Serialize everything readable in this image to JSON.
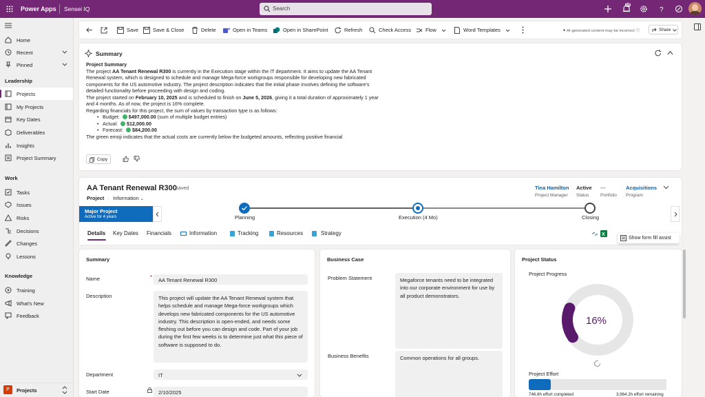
{
  "topbar": {
    "app_name": "Power Apps",
    "env_name": "Sensei IQ",
    "search_placeholder": "Search",
    "notification_count": "18",
    "colors": {
      "brand": "#742774",
      "accent": "#0f6cbd"
    }
  },
  "sidebar": {
    "top_items": [
      {
        "label": "Home",
        "icon": "home-icon"
      },
      {
        "label": "Recent",
        "icon": "clock-icon"
      },
      {
        "label": "Pinned",
        "icon": "pin-icon"
      }
    ],
    "groups": [
      {
        "title": "Leadership",
        "items": [
          "Projects",
          "My Projects",
          "Key Dates",
          "Deliverables",
          "Insights",
          "Project Summary"
        ]
      },
      {
        "title": "Work",
        "items": [
          "Tasks",
          "Issues",
          "Risks",
          "Decisions",
          "Changes",
          "Lessons"
        ]
      },
      {
        "title": "Knowledge",
        "items": [
          "Training",
          "What's New",
          "Feedback"
        ]
      }
    ],
    "area_badge": "P",
    "area_label": "Projects"
  },
  "commandbar": {
    "save": "Save",
    "save_close": "Save & Close",
    "delete": "Delete",
    "open_teams": "Open in Teams",
    "open_sharepoint": "Open in SharePoint",
    "refresh": "Refresh",
    "check_access": "Check Access",
    "flow": "Flow",
    "word_templates": "Word Templates",
    "ai_notice": "AI-generated content may be incorrect",
    "share": "Share"
  },
  "summary": {
    "title": "Summary",
    "heading": "Project Summary",
    "p1_a": "The project ",
    "p1_b": "AA Tenant Renewal R300",
    "p1_c": " is currently in the Execution stage within the IT department. It aims to update the AA Tenant Renewal system, which is designed to schedule and manage Mega-force workgroups responsible for developing new fabricated components for the US automotive industry. The project description indicates that the initial phase involves defining the software's detailed functionality before proceeding with design and coding.",
    "p2_a": "The project started on ",
    "p2_b": "February 10, 2025",
    "p2_c": " and is scheduled to finish on ",
    "p2_d": "June 5, 2026",
    "p2_e": ", giving it a total duration of approximately 1 year and 4 months. As of now, the project is 16% complete.",
    "p3": "Regarding financials for this project, the sum of values by transaction type is as follows:",
    "budget_label": "Budget:",
    "budget_value": "$497,000.00",
    "budget_note": "(sum of multiple budget entries)",
    "actual_label": "Actual:",
    "actual_value": "$12,000.00",
    "forecast_label": "Forecast:",
    "forecast_value": "$84,200.00",
    "p4": "The green emoji indicates that the actual costs are currently below the budgeted amounts, reflecting positive financial",
    "copy": "Copy"
  },
  "record": {
    "title": "AA Tenant Renewal R300",
    "saved": "- Saved",
    "entity": "Project",
    "form": "Information",
    "header_fields": [
      {
        "value": "Tina Hamilton",
        "label": "Project Manager"
      },
      {
        "value": "Active",
        "label": "Status"
      },
      {
        "value": "---",
        "label": "Portfolio"
      },
      {
        "value": "Acquisitions",
        "label": "Program"
      }
    ],
    "bpf_name": "Major Project",
    "bpf_duration": "Active for 4 years",
    "stages": [
      "Planning",
      "Execution",
      "Closing"
    ],
    "execution_duration": "(4 Mo)",
    "tabs": [
      "Details",
      "Key Dates",
      "Financials",
      "Information",
      "Tracking",
      "Resources",
      "Strategy"
    ],
    "form_fill": "Show form fill assist"
  },
  "details": {
    "section_title": "Summary",
    "name_label": "Name",
    "name_value": "AA Tenant Renewal R300",
    "desc_label": "Description",
    "desc_value": "This project will update the AA Tenant Renewal system that helps schedule and manage Mega-force workgroups which develops new fabricated components for the US automotive industry. This description is open-ended, and needs some fleshing out before you can design and code. Part of your job during the first few weeks is to determine just what this piece of software is supposed to do.",
    "dept_label": "Department",
    "dept_value": "IT",
    "start_label": "Start Date",
    "start_value": "2/10/2025"
  },
  "business_case": {
    "title": "Business Case",
    "problem_label": "Problem Statement",
    "problem_value": "Megaforce tenants need to be integrated into our corporate environment for use by all product demonstrators.",
    "benefits_label": "Business Benefits",
    "benefits_value": "Common operations for all groups."
  },
  "project_status": {
    "title": "Project Status",
    "progress_label": "Project Progress",
    "progress_text": "16%",
    "progress_value": 0.16,
    "effort_label": "Project Effort",
    "effort_completed": "746.8h effort completed",
    "effort_remaining": "3,964.2h effort remaining",
    "effort_fraction": 0.158
  }
}
